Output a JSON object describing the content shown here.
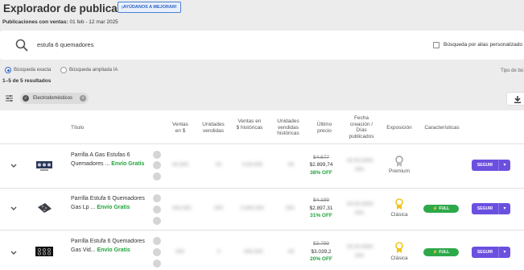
{
  "header": {
    "title": "Explorador de publicaciones",
    "help_button": "¡AYÚDANOS A MEJORAR!",
    "sales_label": "Publicaciones con ventas:",
    "sales_range": "01 feb - 12 mar 2025"
  },
  "search": {
    "value": "estufa 6 quemadores",
    "alias_label": "Búsqueda por alias personalizado",
    "alias_checked": false
  },
  "mode": {
    "exact_label": "Búsqueda exacta",
    "ai_label": "Búsqueda ampliada IA",
    "selected": "exact",
    "tipo_label": "Tipo de bú"
  },
  "results_count": "1–5 de 5 resultados",
  "filters": {
    "chip_label": "Electrodomésticos"
  },
  "table": {
    "columns": {
      "titulo": "Título",
      "ventas": "Ventas en $",
      "unidades": "Unidades vendidas",
      "ventas_hist": "Ventas en $ históricas",
      "unidades_hist": "Unidades vendidas históricas",
      "ultimo_precio": "Último precio",
      "fecha": "Fecha creación / Días publicados",
      "exposicion": "Exposición",
      "caracteristicas": "Características"
    },
    "rows": [
      {
        "title": "Parrilla A Gas Estufas 6 Quemadores ...",
        "envio": "Envío Gratis",
        "ventas": "00.000",
        "unidades": "00",
        "ventas_hist": "0.00.000",
        "unidades_hist": "00",
        "price_old": "$4.677",
        "price_now": "$2.899,74",
        "discount": "38% OFF",
        "fecha": "00.00.0000",
        "dias": "000",
        "exposicion": "Premium",
        "full": "",
        "seguir": "SEGUIR"
      },
      {
        "title": "Parrilla Estufa 6 Quemadores Gas Lp ...",
        "envio": "Envío Gratis",
        "ventas": "000.000",
        "unidades": "000",
        "ventas_hist": "0.000.000",
        "unidades_hist": "000",
        "price_old": "$4.199",
        "price_now": "$2.897,31",
        "discount": "31% OFF",
        "fecha": "00.00.0000",
        "dias": "000",
        "exposicion": "Clásica",
        "full": "FULL",
        "seguir": "SEGUIR"
      },
      {
        "title": "Parrilla Estufa 6 Quemadores Gas Vid...",
        "envio": "Envío Gratis",
        "ventas": "000",
        "unidades": "0",
        "ventas_hist": "000.000",
        "unidades_hist": "00",
        "price_old": "$3.799",
        "price_now": "$3.039,2",
        "discount": "20% OFF",
        "fecha": "00.00.0000",
        "dias": "000",
        "exposicion": "Clásica",
        "full": "FULL",
        "seguir": "SEGUIR"
      }
    ]
  },
  "colors": {
    "accent": "#2f62c7",
    "purple": "#6b50e0",
    "green": "#23a33c",
    "full_green": "#2ea94a",
    "gold": "#f0c419"
  }
}
